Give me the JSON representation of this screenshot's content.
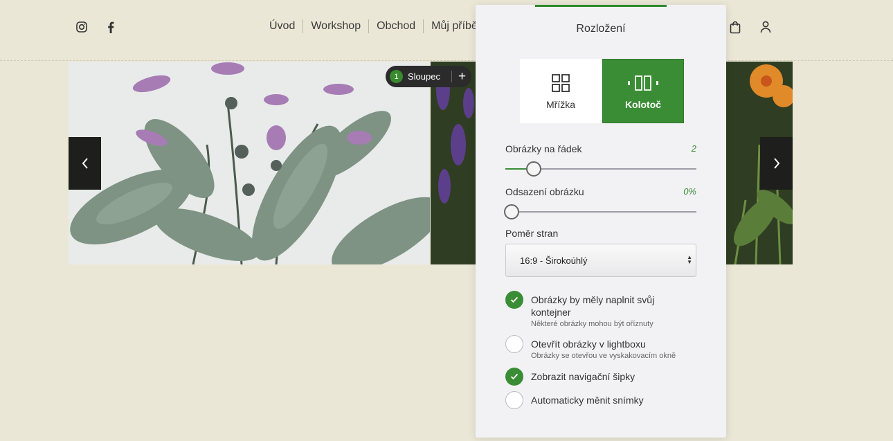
{
  "header": {
    "social": [
      "instagram-icon",
      "facebook-icon"
    ],
    "nav": [
      "Úvod",
      "Workshop",
      "Obchod",
      "Můj příbě"
    ],
    "actions": [
      "shopping-bag-icon",
      "user-icon"
    ]
  },
  "carousel": {
    "column_chip": {
      "number": "1",
      "label": "Sloupec",
      "add": "+"
    }
  },
  "panel": {
    "title": "Rozložení",
    "tabs": [
      {
        "label": "Mřížka",
        "icon": "grid-icon",
        "selected": false
      },
      {
        "label": "Kolotoč",
        "icon": "carousel-icon",
        "selected": true
      }
    ],
    "per_row": {
      "label": "Obrázky na řádek",
      "value": "2",
      "fraction": 0.15
    },
    "spacing": {
      "label": "Odsazení obrázku",
      "value": "0%",
      "fraction": 0
    },
    "aspect": {
      "label": "Poměr stran",
      "selected": "16:9 - Širokoúhlý"
    },
    "options": [
      {
        "title": "Obrázky by měly naplnit svůj kontejner",
        "sub": "Některé obrázky mohou být oříznuty",
        "checked": true
      },
      {
        "title": "Otevřít obrázky v lightboxu",
        "sub": "Obrázky se otevřou ve vyskakovacím okně",
        "checked": false
      },
      {
        "title": "Zobrazit navigační šipky",
        "sub": "",
        "checked": true
      },
      {
        "title": "Automaticky měnit snímky",
        "sub": "",
        "checked": false
      }
    ]
  },
  "colors": {
    "accent": "#3a8d35",
    "page_bg": "#ebe7d7",
    "panel_bg": "#f2f2f5"
  }
}
